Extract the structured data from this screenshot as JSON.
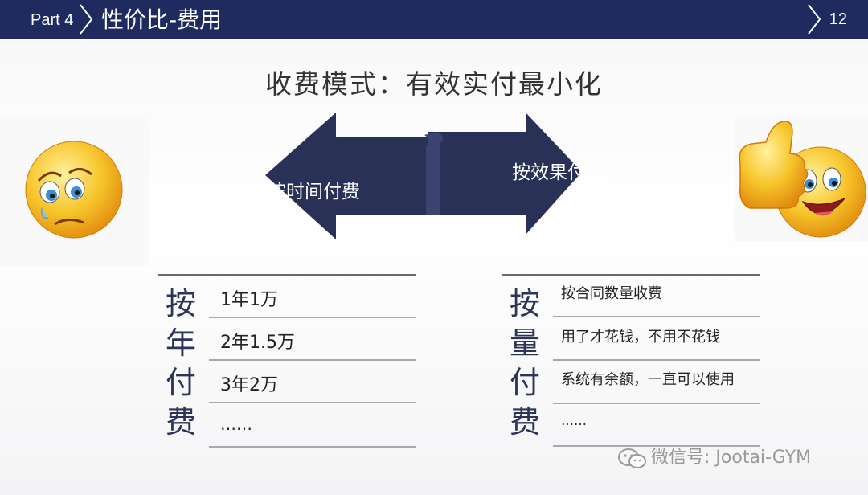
{
  "header": {
    "part_label": "Part 4",
    "title": "性价比-费用",
    "page_number": "12"
  },
  "main_title": "收费模式：有效实付最小化",
  "arrows": {
    "left_label": "按时间付费",
    "right_label": "按效果付费"
  },
  "left_panel": {
    "heading_chars": [
      "按",
      "年",
      "付",
      "费"
    ],
    "items": [
      "1年1万",
      "2年1.5万",
      "3年2万",
      "……"
    ]
  },
  "right_panel": {
    "heading_chars": [
      "按",
      "量",
      "付",
      "费"
    ],
    "items": [
      "按合同数量收费",
      "用了才花钱，不用不花钱",
      "系统有余额，一直可以使用",
      "……"
    ]
  },
  "watermark": "微信号: Jootai-GYM",
  "icons": [
    "sad-face-icon",
    "thumbs-up-happy-face-icon",
    "wechat-icon"
  ],
  "colors": {
    "header_bg": "#1f2b5e",
    "arrow": "#2a3157",
    "emoji_yellow": "#f7c52b"
  }
}
